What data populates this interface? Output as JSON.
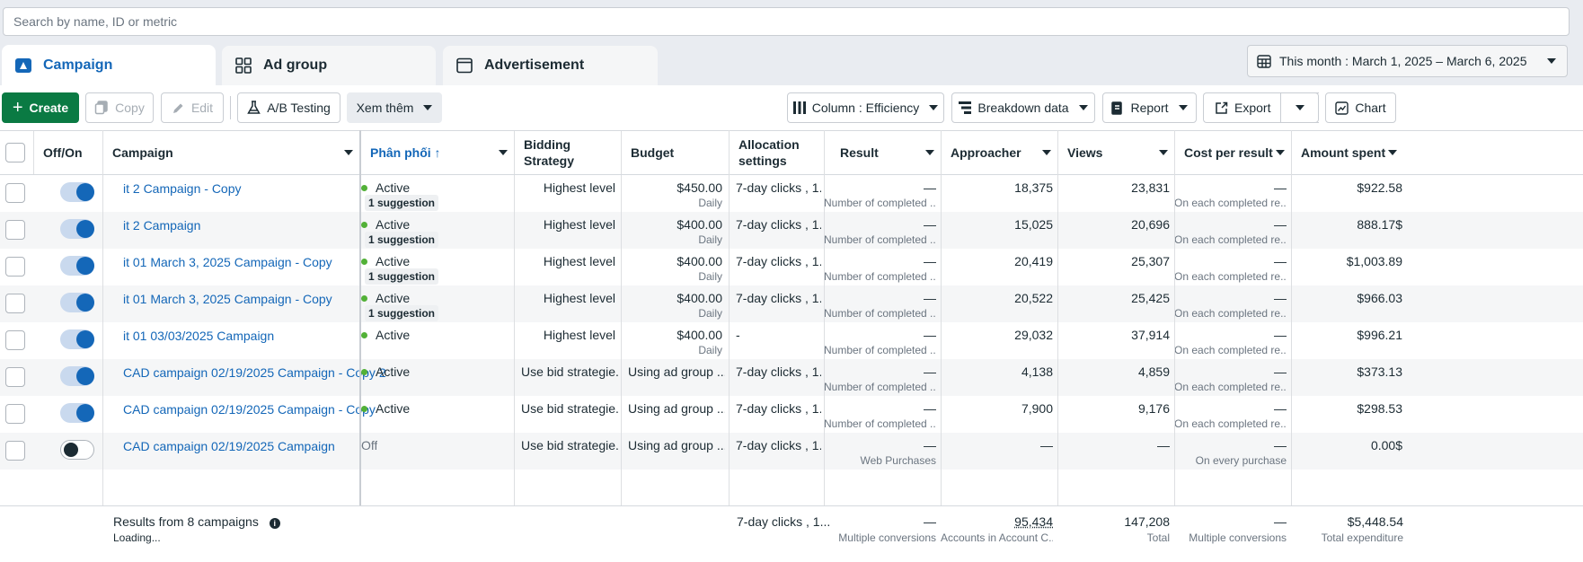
{
  "search": {
    "placeholder": "Search by name, ID or metric"
  },
  "tabs": [
    {
      "label": "Campaign",
      "icon": "folder-icon",
      "active": true
    },
    {
      "label": "Ad group",
      "icon": "grid-icon",
      "active": false
    },
    {
      "label": "Advertisement",
      "icon": "ad-icon",
      "active": false
    }
  ],
  "date_range": {
    "label": "This month : March 1, 2025 – March 6, 2025"
  },
  "toolbar": {
    "create": "Create",
    "copy": "Copy",
    "edit": "Edit",
    "ab_testing": "A/B Testing",
    "more": "Xem thêm",
    "columns": "Column : Efficiency",
    "breakdown": "Breakdown data",
    "report": "Report",
    "export": "Export",
    "chart": "Chart"
  },
  "columns": {
    "offon": "Off/On",
    "campaign": "Campaign",
    "delivery": "Phân phối ↑",
    "bidding": "Bidding Strategy",
    "budget": "Budget",
    "allocation": "Allocation settings",
    "result": "Result",
    "reach": "Approacher",
    "views": "Views",
    "cpr": "Cost per result",
    "spent": "Amount spent"
  },
  "rows": [
    {
      "name": "it 2 Campaign - Copy",
      "on": true,
      "status": "Active",
      "suggestion": "1 suggestion",
      "bidding": "Highest level",
      "budget": "$450.00",
      "budget_period": "Daily",
      "allocation": "7-day clicks , 1...",
      "result": "—",
      "result_sub": "Number of completed ...",
      "reach": "18,375",
      "views": "23,831",
      "cpr": "—",
      "cpr_sub": "On each completed re...",
      "spent": "$922.58"
    },
    {
      "name": "it 2 Campaign",
      "on": true,
      "status": "Active",
      "suggestion": "1 suggestion",
      "bidding": "Highest level",
      "budget": "$400.00",
      "budget_period": "Daily",
      "allocation": "7-day clicks , 1...",
      "result": "—",
      "result_sub": "Number of completed ...",
      "reach": "15,025",
      "views": "20,696",
      "cpr": "—",
      "cpr_sub": "On each completed re...",
      "spent": "888.17$"
    },
    {
      "name": "it 01 March 3, 2025 Campaign - Copy",
      "on": true,
      "status": "Active",
      "suggestion": "1 suggestion",
      "bidding": "Highest level",
      "budget": "$400.00",
      "budget_period": "Daily",
      "allocation": "7-day clicks , 1...",
      "result": "—",
      "result_sub": "Number of completed ...",
      "reach": "20,419",
      "views": "25,307",
      "cpr": "—",
      "cpr_sub": "On each completed re...",
      "spent": "$1,003.89"
    },
    {
      "name": "it 01 March 3, 2025 Campaign - Copy",
      "on": true,
      "status": "Active",
      "suggestion": "1 suggestion",
      "bidding": "Highest level",
      "budget": "$400.00",
      "budget_period": "Daily",
      "allocation": "7-day clicks , 1...",
      "result": "—",
      "result_sub": "Number of completed ...",
      "reach": "20,522",
      "views": "25,425",
      "cpr": "—",
      "cpr_sub": "On each completed re...",
      "spent": "$966.03"
    },
    {
      "name": "it 01 03/03/2025 Campaign",
      "on": true,
      "status": "Active",
      "suggestion": "",
      "bidding": "Highest level",
      "budget": "$400.00",
      "budget_period": "Daily",
      "allocation": "-",
      "result": "—",
      "result_sub": "Number of completed ...",
      "reach": "29,032",
      "views": "37,914",
      "cpr": "—",
      "cpr_sub": "On each completed re...",
      "spent": "$996.21"
    },
    {
      "name": "CAD campaign 02/19/2025 Campaign - Copy 2",
      "on": true,
      "status": "Active",
      "suggestion": "",
      "bidding": "Use bid strategie...",
      "budget": "Using ad group ...",
      "budget_period": "",
      "allocation": "7-day clicks , 1...",
      "result": "—",
      "result_sub": "Number of completed ...",
      "reach": "4,138",
      "views": "4,859",
      "cpr": "—",
      "cpr_sub": "On each completed re...",
      "spent": "$373.13"
    },
    {
      "name": "CAD campaign 02/19/2025 Campaign - Copy",
      "on": true,
      "status": "Active",
      "suggestion": "",
      "bidding": "Use bid strategie...",
      "budget": "Using ad group ...",
      "budget_period": "",
      "allocation": "7-day clicks , 1...",
      "result": "—",
      "result_sub": "Number of completed ...",
      "reach": "7,900",
      "views": "9,176",
      "cpr": "—",
      "cpr_sub": "On each completed re...",
      "spent": "$298.53"
    },
    {
      "name": "CAD campaign 02/19/2025 Campaign",
      "on": false,
      "status": "Off",
      "suggestion": "",
      "bidding": "Use bid strategie...",
      "budget": "Using ad group ...",
      "budget_period": "",
      "allocation": "7-day clicks , 1...",
      "result": "—",
      "result_sub": "Web Purchases",
      "reach": "—",
      "views": "—",
      "cpr": "—",
      "cpr_sub": "On every purchase",
      "spent": "0.00$"
    }
  ],
  "summary": {
    "label": "Results from 8 campaigns",
    "loading": "Loading...",
    "allocation": "7-day clicks , 1...",
    "result": "—",
    "result_sub": "Multiple conversions",
    "reach": "95,434",
    "reach_sub": "Accounts in Account C...",
    "views": "147,208",
    "views_sub": "Total",
    "cpr": "—",
    "cpr_sub": "Multiple conversions",
    "spent": "$5,448.54",
    "spent_sub": "Total expenditure"
  },
  "colors": {
    "accent": "#1467b8",
    "create_green": "#0a7a43",
    "active_dot": "#52b137"
  }
}
